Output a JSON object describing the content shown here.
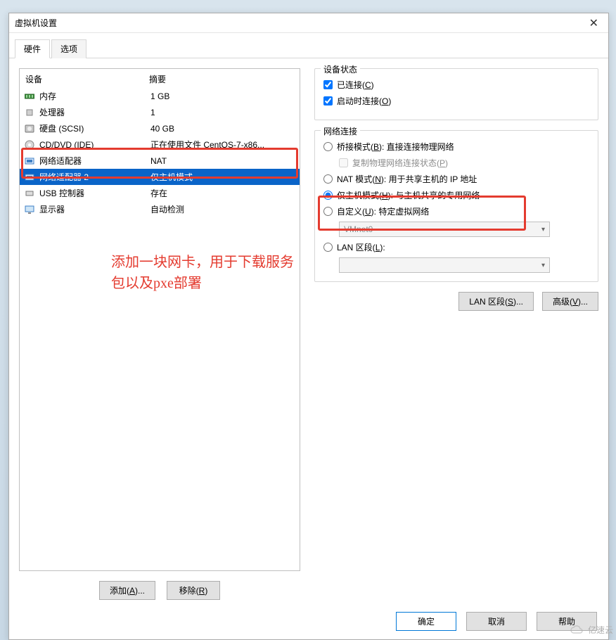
{
  "window": {
    "title": "虚拟机设置"
  },
  "tabs": {
    "hardware": "硬件",
    "options": "选项"
  },
  "hw": {
    "col_device": "设备",
    "col_summary": "摘要",
    "memory": {
      "name": "内存",
      "summary": "1 GB"
    },
    "cpu": {
      "name": "处理器",
      "summary": "1"
    },
    "disk": {
      "name": "硬盘 (SCSI)",
      "summary": "40 GB"
    },
    "cd": {
      "name": "CD/DVD (IDE)",
      "summary": "正在使用文件 CentOS-7-x86..."
    },
    "net1": {
      "name": "网络适配器",
      "summary": "NAT"
    },
    "net2": {
      "name": "网络适配器 2",
      "summary": "仅主机模式"
    },
    "usb": {
      "name": "USB 控制器",
      "summary": "存在"
    },
    "display": {
      "name": "显示器",
      "summary": "自动检测"
    }
  },
  "annotation": "添加一块网卡，用于下载服务包以及pxe部署",
  "device_state": {
    "title": "设备状态",
    "connected": "已连接(C)",
    "connect_at_poweron": "启动时连接(O)"
  },
  "netconn": {
    "title": "网络连接",
    "bridged_pre": "桥接模式(",
    "bridged_u": "B",
    "bridged_post": "): 直接连接物理网络",
    "replicate_pre": "复制物理网络连接状态(",
    "replicate_u": "P",
    "replicate_post": ")",
    "nat_pre": "NAT 模式(",
    "nat_u": "N",
    "nat_post": "): 用于共享主机的 IP 地址",
    "host_pre": "仅主机模式(",
    "host_u": "H",
    "host_post": "): 与主机共享的专用网络",
    "custom_pre": "自定义(",
    "custom_u": "U",
    "custom_post": "): 特定虚拟网络",
    "custom_net": "VMnet0",
    "lan_pre": "LAN 区段(",
    "lan_u": "L",
    "lan_post": "):",
    "lan_val": ""
  },
  "buttons": {
    "add_pre": "添加(",
    "add_u": "A",
    "add_post": ")...",
    "remove_pre": "移除(",
    "remove_u": "R",
    "remove_post": ")",
    "lan_seg_pre": "LAN 区段(",
    "lan_seg_u": "S",
    "lan_seg_post": ")...",
    "adv_pre": "高级(",
    "adv_u": "V",
    "adv_post": ")...",
    "ok": "确定",
    "cancel": "取消",
    "help": "帮助"
  },
  "watermark": "亿速云"
}
